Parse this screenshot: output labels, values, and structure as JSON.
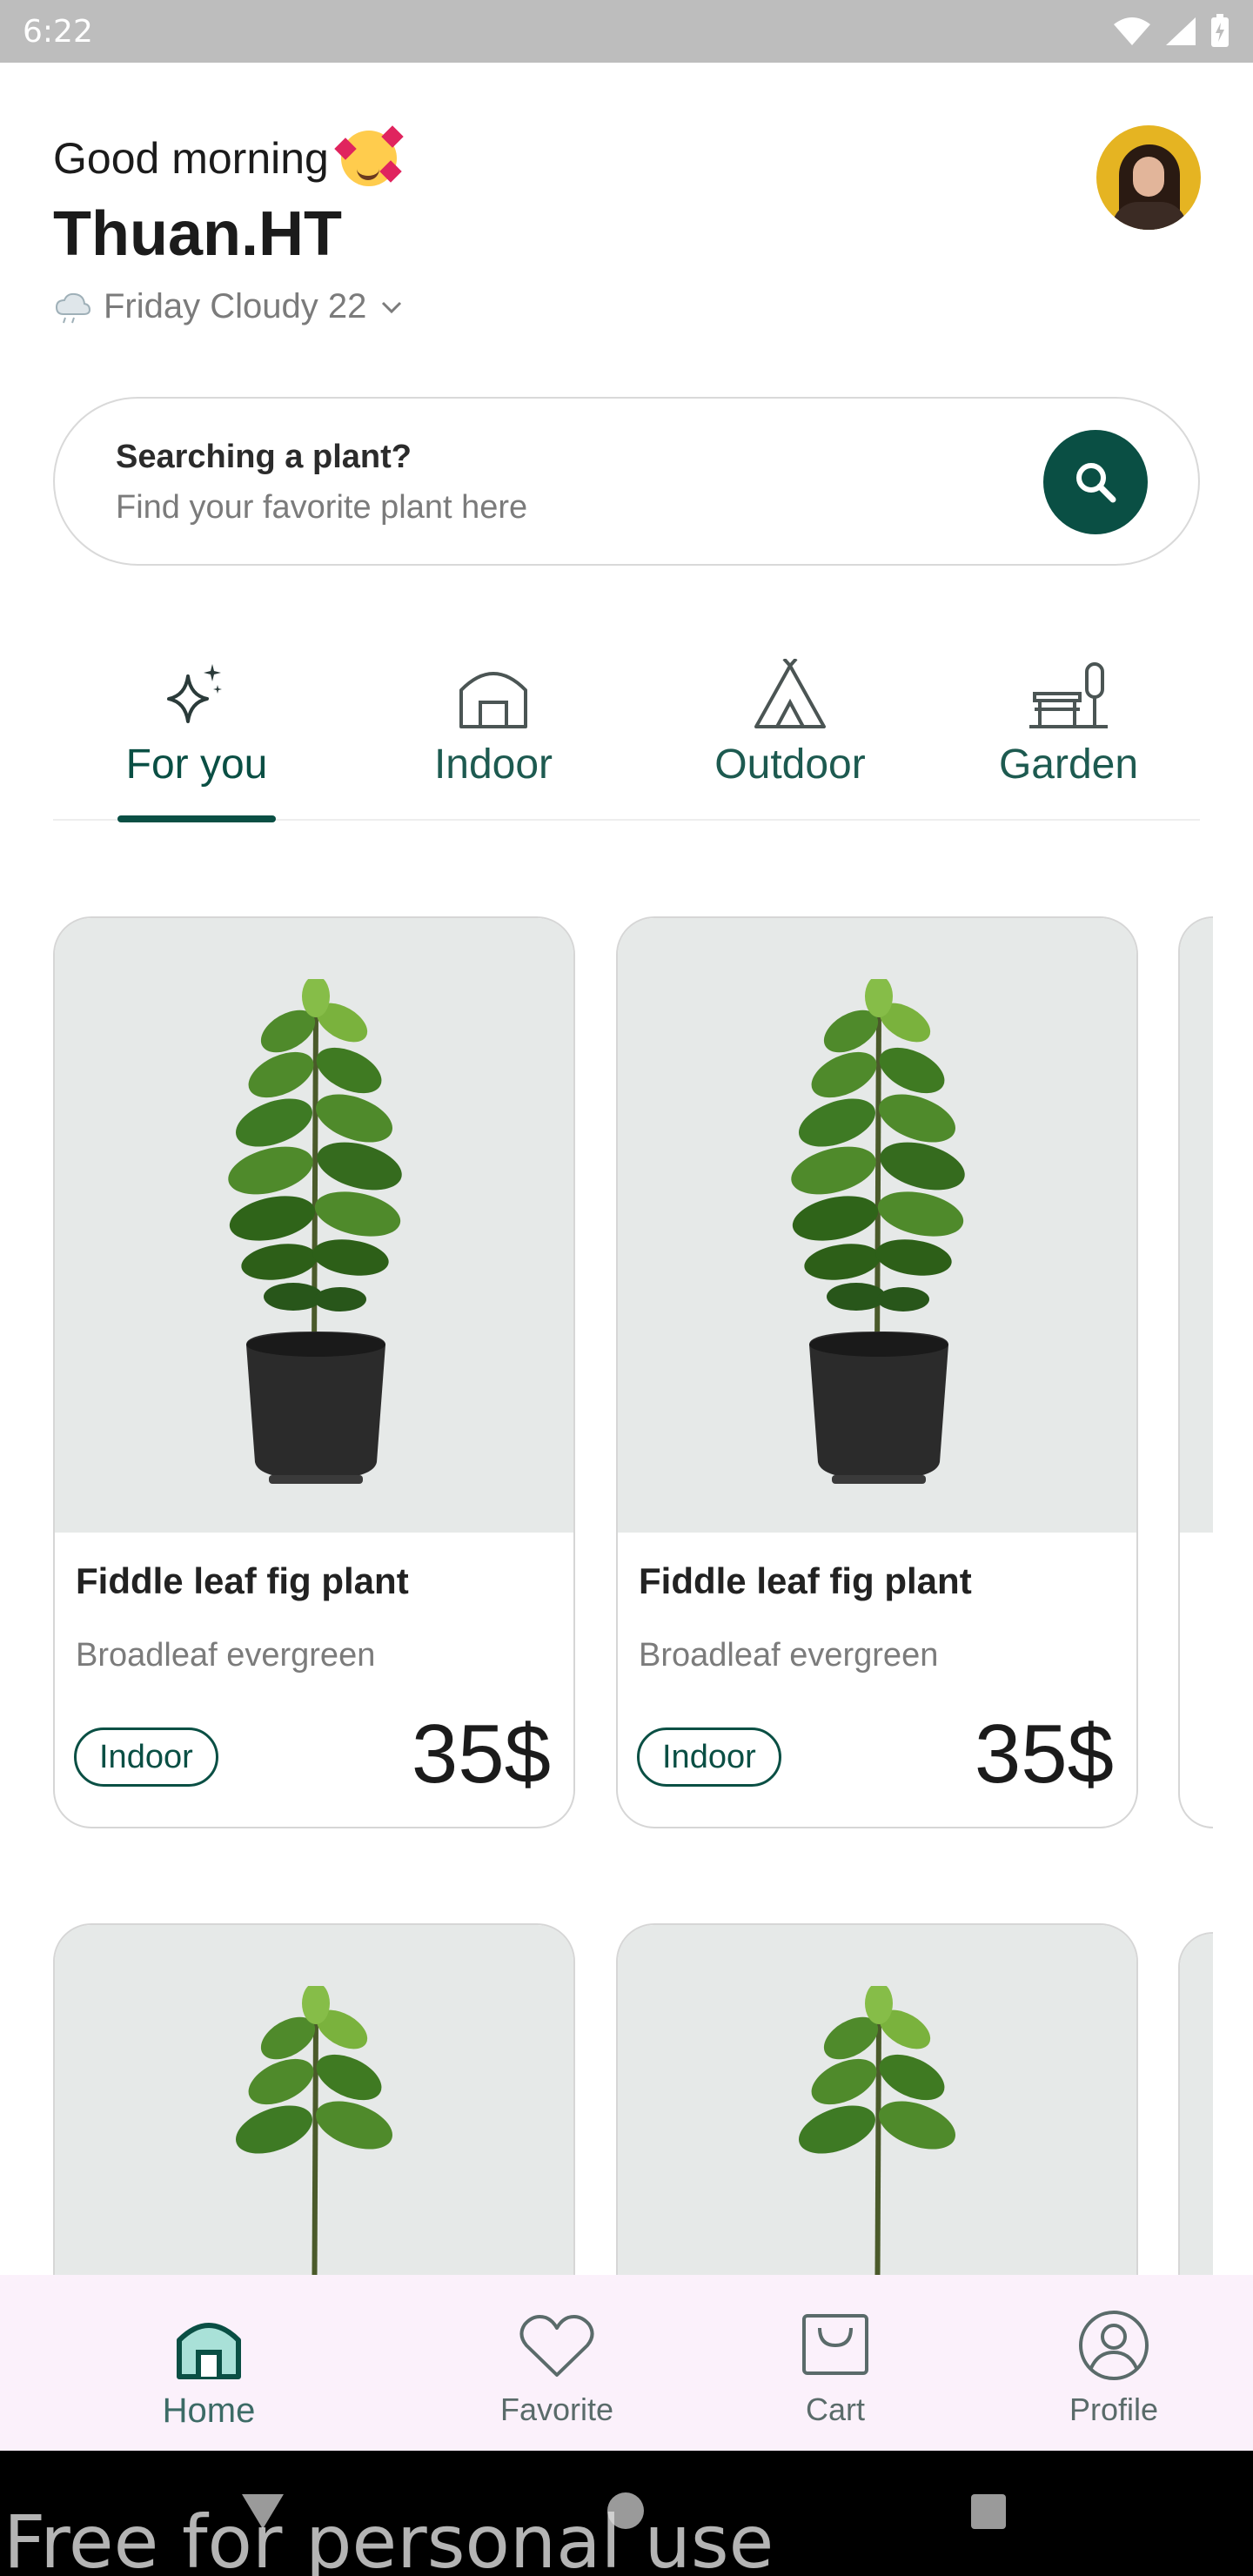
{
  "status_bar": {
    "time": "6:22"
  },
  "header": {
    "greeting": "Good morning",
    "greeting_emoji": "smiling-face-with-hearts",
    "username": "Thuan.HT",
    "weather": "Friday Cloudy 22"
  },
  "search": {
    "title": "Searching a plant?",
    "placeholder": "Find your favorite plant here"
  },
  "tabs": [
    {
      "label": "For you",
      "icon": "sparkle-icon",
      "active": true
    },
    {
      "label": "Indoor",
      "icon": "house-icon",
      "active": false
    },
    {
      "label": "Outdoor",
      "icon": "tent-icon",
      "active": false
    },
    {
      "label": "Garden",
      "icon": "bench-icon",
      "active": false
    }
  ],
  "products": [
    {
      "name": "Fiddle leaf fig plant",
      "type": "Broadleaf evergreen",
      "category": "Indoor",
      "price": "35$"
    },
    {
      "name": "Fiddle leaf fig plant",
      "type": "Broadleaf evergreen",
      "category": "Indoor",
      "price": "35$"
    }
  ],
  "bottom_nav": [
    {
      "label": "Home",
      "icon": "home-icon",
      "active": true
    },
    {
      "label": "Favorite",
      "icon": "heart-icon",
      "active": false
    },
    {
      "label": "Cart",
      "icon": "cart-icon",
      "active": false
    },
    {
      "label": "Profile",
      "icon": "profile-icon",
      "active": false
    }
  ],
  "watermark": "Free for personal use",
  "colors": {
    "primary": "#0a4f44",
    "card_image_bg": "#e6e9e8",
    "bottom_nav_bg": "#fbf1fb",
    "status_bar_bg": "#bdbdbd"
  }
}
